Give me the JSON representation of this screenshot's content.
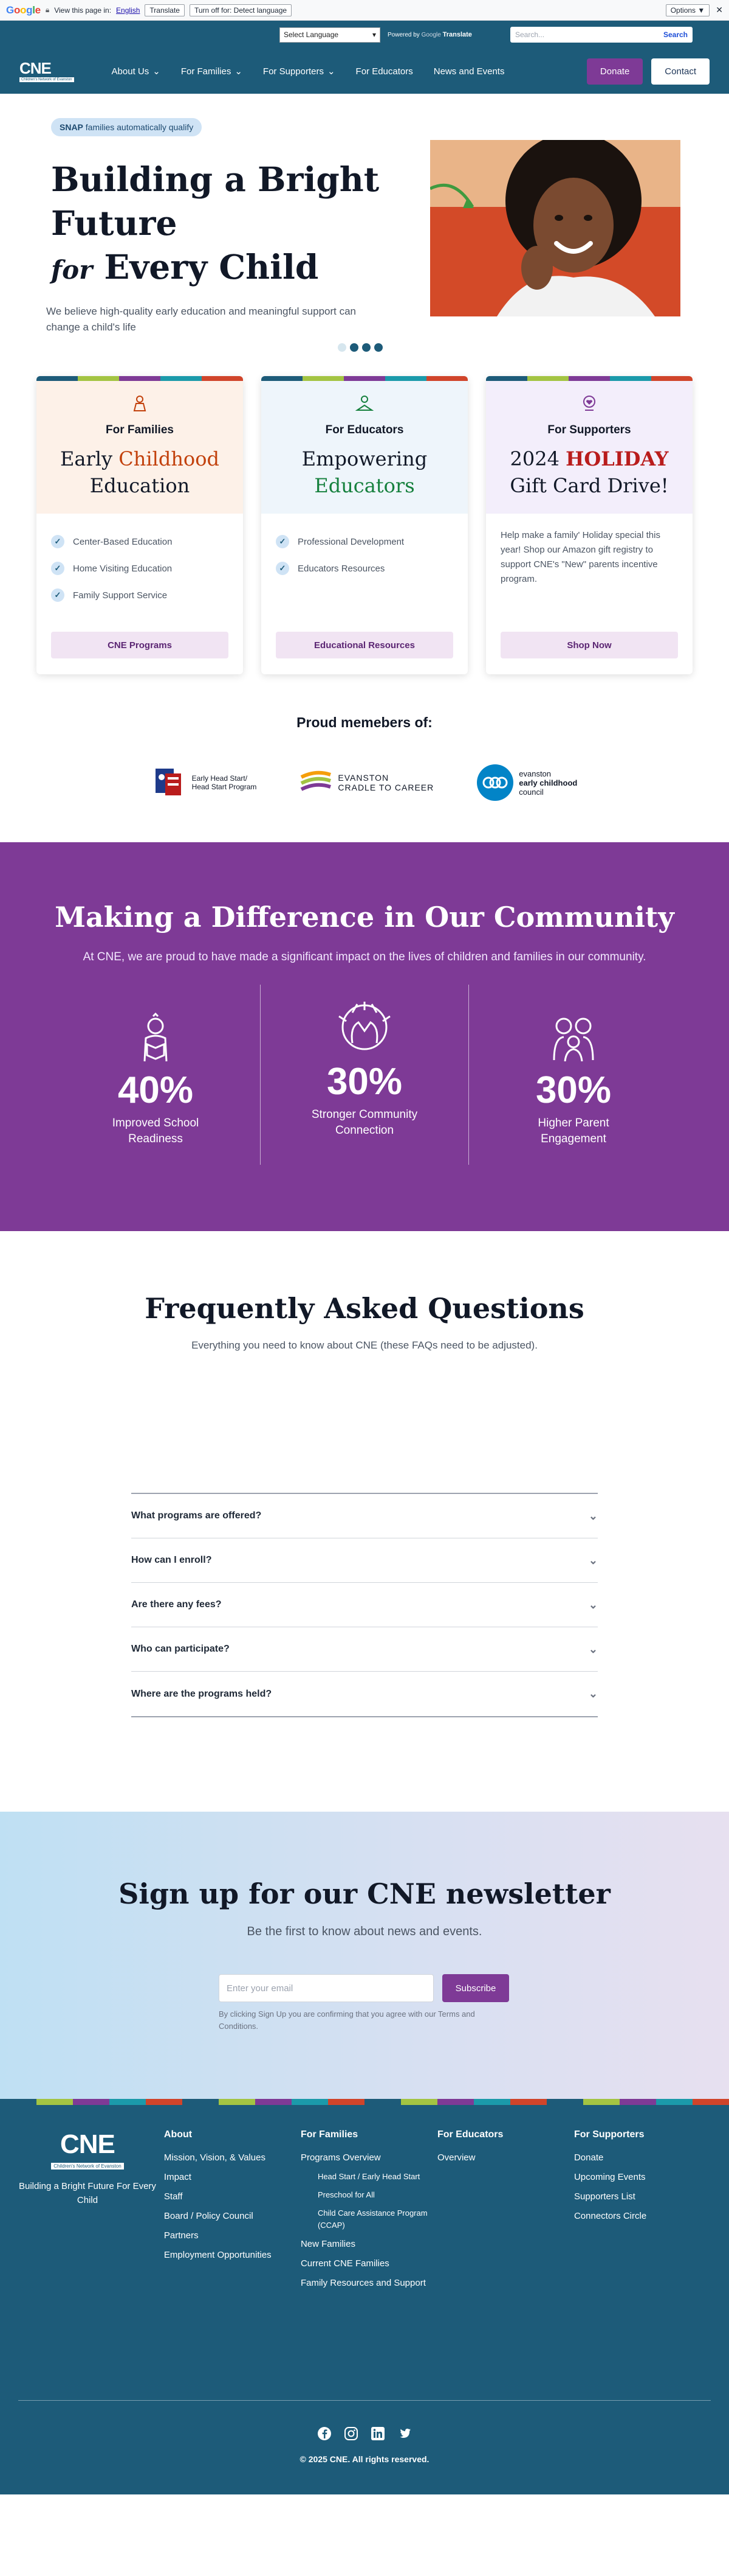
{
  "translate_bar": {
    "view_label": "View this page in:",
    "language": "English",
    "translate_button": "Translate",
    "turn_off_button": "Turn off for: Detect language",
    "options_button": "Options ▼"
  },
  "top_strip": {
    "language_select": "Select Language",
    "powered_by": "Powered by",
    "google": "Google",
    "translate": "Translate",
    "search_placeholder": "Search...",
    "search_button": "Search"
  },
  "nav": {
    "logo": "CNE",
    "logo_sub": "Children's Network of Evanston",
    "items": [
      "About Us",
      "For Families",
      "For Supporters",
      "For Educators",
      "News and Events"
    ],
    "donate": "Donate",
    "contact": "Contact"
  },
  "hero": {
    "badge_bold": "SNAP",
    "badge_rest": " families automatically qualify",
    "title_line1": "Building a Bright",
    "title_line2": "Future",
    "title_for": "for",
    "title_line3": " Every Child",
    "lead": "We believe high-quality early education and meaningful support can change a child's life"
  },
  "cards": [
    {
      "for": "For Families",
      "title_a": "Early ",
      "title_accent": "Childhood",
      "title_b": "Education",
      "items": [
        "Center-Based Education",
        "Home Visiting Education",
        "Family Support Service"
      ],
      "button": "CNE Programs"
    },
    {
      "for": "For Educators",
      "title_a": "Empowering",
      "title_accent": "Educators",
      "items": [
        "Professional Development",
        "Educators Resources"
      ],
      "button": "Educational Resources"
    },
    {
      "for": "For Supporters",
      "title_a": "2024 ",
      "title_accent": "HOLIDAY",
      "title_b": "Gift Card Drive!",
      "text": "Help make a family' Holiday special this year! Shop our Amazon gift registry to support CNE's \"New\" parents incentive program.",
      "button": "Shop Now"
    }
  ],
  "members": {
    "heading": "Proud memebers of:",
    "logos": [
      {
        "line1": "Early Head Start/",
        "line2": "Head Start Program"
      },
      {
        "line1": "EVANSTON",
        "line2": "CRADLE TO CAREER"
      },
      {
        "line1": "evanston",
        "line2": "early childhood",
        "line3": "council"
      }
    ]
  },
  "impact": {
    "title": "Making a Difference in Our Community",
    "subtitle": "At CNE, we are proud to have made a significant impact on the lives of children and families in our community.",
    "stats": [
      {
        "value": "40%",
        "label": "Improved School Readiness"
      },
      {
        "value": "30%",
        "label": "Stronger Community Connection"
      },
      {
        "value": "30%",
        "label": "Higher Parent Engagement"
      }
    ]
  },
  "faq": {
    "title": "Frequently Asked Questions",
    "subtitle": "Everything you need to know about CNE (these FAQs need to be adjusted).",
    "questions": [
      "What programs are offered?",
      "How can I enroll?",
      "Are there any fees?",
      "Who can participate?",
      "Where are the programs held?"
    ]
  },
  "newsletter": {
    "title": "Sign up for our CNE newsletter",
    "subtitle": "Be the first to know about news and events.",
    "placeholder": "Enter your email",
    "button": "Subscribe",
    "note": "By clicking Sign Up you are confirming that you agree with our Terms and Conditions."
  },
  "footer": {
    "logo": "CNE",
    "logo_sub": "Children's Network of Evanston",
    "tagline": "Building a Bright Future For Every Child",
    "columns": [
      {
        "heading": "About",
        "links": [
          "Mission, Vision, & Values",
          "Impact",
          "Staff",
          "Board / Policy Council",
          "Partners",
          "Employment Opportunities"
        ]
      },
      {
        "heading": "For Families",
        "links": [
          "Programs Overview"
        ],
        "sublinks": [
          "Head Start / Early Head Start",
          "Preschool for All",
          "Child Care Assistance Program (CCAP)"
        ],
        "links2": [
          "New Families",
          "Current CNE Families",
          "Family Resources and Support"
        ]
      },
      {
        "heading": "For Educators",
        "links": [
          "Overview"
        ]
      },
      {
        "heading": "For Supporters",
        "links": [
          "Donate",
          "Upcoming Events",
          "Supporters List",
          "Connectors Circle"
        ]
      }
    ],
    "copyright": "© 2025 CNE. All rights reserved."
  },
  "colors": {
    "primary": "#1d5b79",
    "purple": "#7e3a96",
    "stripe": [
      "#1d5b79",
      "#a3c442",
      "#7e3a96",
      "#1b9aaa",
      "#d0442a"
    ]
  }
}
